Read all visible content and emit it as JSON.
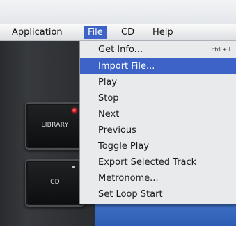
{
  "menubar": {
    "items": [
      "Application",
      "File",
      "CD",
      "Help"
    ],
    "active": "File"
  },
  "file_menu": {
    "items": [
      {
        "label": "Get Info...",
        "shortcut": "ctrl + I"
      },
      {
        "label": "Import File...",
        "highlighted": true
      },
      {
        "label": "Play"
      },
      {
        "label": "Stop"
      },
      {
        "label": "Next"
      },
      {
        "label": "Previous"
      },
      {
        "label": "Toggle Play"
      },
      {
        "label": "Export Selected Track"
      },
      {
        "label": "Metronome..."
      },
      {
        "label": "Set Loop Start"
      }
    ]
  },
  "side_buttons": {
    "library": {
      "label": "LIBRARY",
      "led_color": "#e5131b"
    },
    "cd": {
      "label": "CD",
      "led_color": "#c9cbcd"
    }
  },
  "colors": {
    "menu_highlight": "#3d63c9",
    "app_background": "#2a2b2e",
    "accent_panel": "#3f6fc6"
  }
}
